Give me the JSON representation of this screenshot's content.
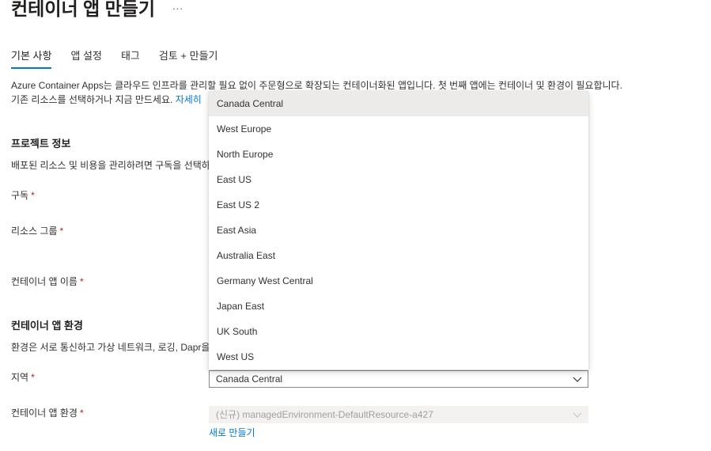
{
  "page": {
    "title": "컨테이너 앱 만들기",
    "more": "..."
  },
  "tabs": [
    {
      "label": "기본 사항"
    },
    {
      "label": "앱 설정"
    },
    {
      "label": "태그"
    },
    {
      "label": "검토 + 만들기"
    }
  ],
  "intro": {
    "line1": "Azure Container Apps는 클라우드 인프라를 관리할 필요 없이 주문형으로 확장되는 컨테이너화된 앱입니다. 첫 번째 앱에는 컨테이너 및 환경이 필요합니다.",
    "line2": "기존 리소스를 선택하거나 지금 만드세요.",
    "learn_more": "자세히"
  },
  "project": {
    "title": "프로젝트 정보",
    "desc": "배포된 리소스 및 비용을 관리하려면 구독을 선택하"
  },
  "fields": {
    "subscription": "구독",
    "resource_group": "리소스 그룹",
    "app_name": "컨테이너 앱 이름",
    "region": "지역",
    "environment": "컨테이너 앱 환경",
    "required_mark": "*"
  },
  "environment_section": {
    "title": "컨테이너 앱 환경",
    "desc": "환경은 서로 통신하고 가상 네트워크, 로깅, Dapr을"
  },
  "region_select": {
    "value": "Canada Central",
    "icon": "chevron-down-icon"
  },
  "environment_select": {
    "value": "(신규) managedEnvironment-DefaultResource-a427",
    "icon": "chevron-down-icon"
  },
  "create_new_link": "새로 만들기",
  "region_options": [
    "Canada Central",
    "West Europe",
    "North Europe",
    "East US",
    "East US 2",
    "East Asia",
    "Australia East",
    "Germany West Central",
    "Japan East",
    "UK South",
    "West US"
  ],
  "colors": {
    "accent": "#0078d4",
    "required": "#a4262c",
    "selected_bg": "#edebe9"
  }
}
